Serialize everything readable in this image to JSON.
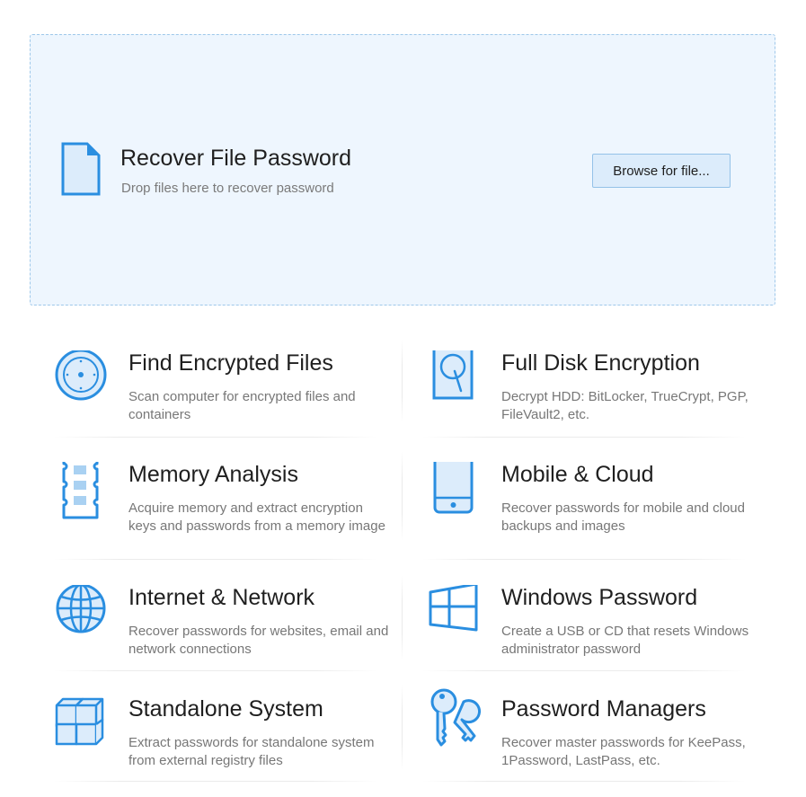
{
  "dropzone": {
    "title": "Recover File Password",
    "subtitle": "Drop files here to recover password",
    "browse_label": "Browse for file...",
    "icon": "document-icon"
  },
  "tiles": [
    {
      "title": "Find Encrypted Files",
      "desc": "Scan computer for encrypted files and containers",
      "icon": "disk-scan-icon"
    },
    {
      "title": "Full Disk Encryption",
      "desc": "Decrypt HDD: BitLocker, TrueCrypt, PGP, FileVault2, etc.",
      "icon": "hard-drive-icon"
    },
    {
      "title": "Memory Analysis",
      "desc": "Acquire memory and extract encryption keys and passwords from a memory image",
      "icon": "memory-chip-icon"
    },
    {
      "title": "Mobile & Cloud",
      "desc": "Recover passwords for mobile and cloud backups and images",
      "icon": "mobile-phone-icon"
    },
    {
      "title": "Internet & Network",
      "desc": "Recover passwords for websites, email and network connections",
      "icon": "globe-icon"
    },
    {
      "title": "Windows Password",
      "desc": "Create a USB or CD that resets Windows administrator password",
      "icon": "windows-logo-icon"
    },
    {
      "title": "Standalone System",
      "desc": "Extract passwords for standalone system from external registry files",
      "icon": "cubes-icon"
    },
    {
      "title": "Password Managers",
      "desc": "Recover master passwords for KeePass, 1Password, LastPass, etc.",
      "icon": "keys-icon"
    }
  ],
  "colors": {
    "accent": "#2a8ee0",
    "icon_fill": "#dcecfb",
    "dropzone_bg": "#eef6fe"
  }
}
